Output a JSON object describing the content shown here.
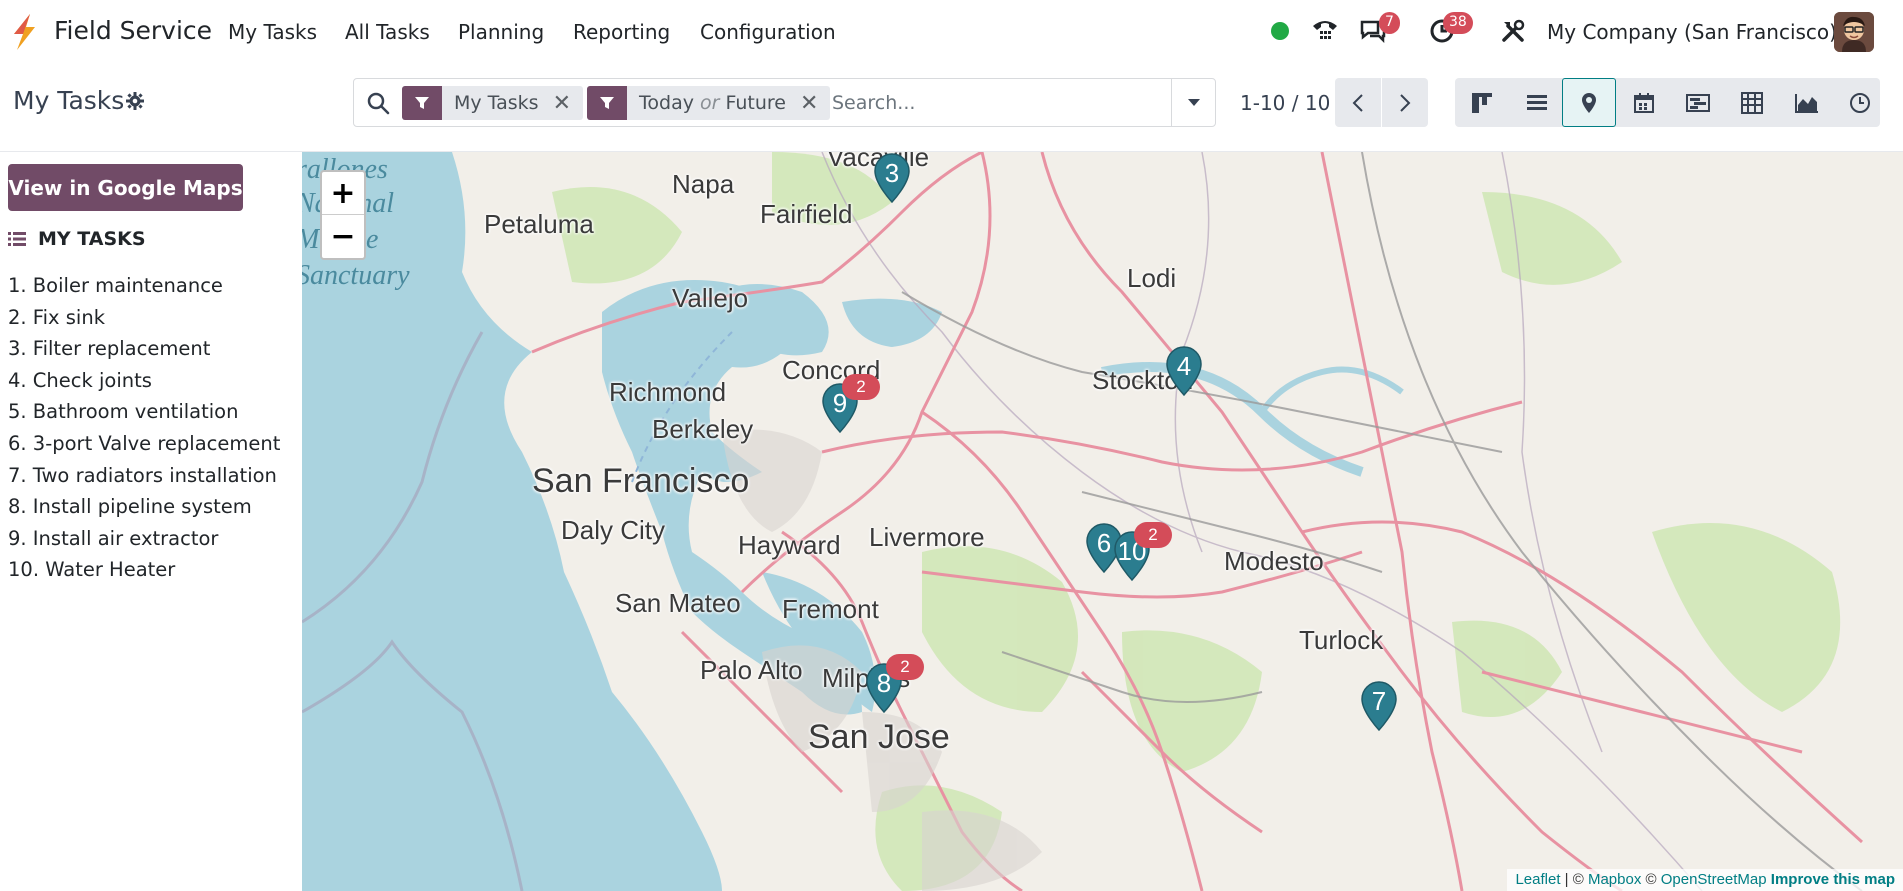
{
  "app": {
    "name": "Field Service"
  },
  "menu": [
    "My Tasks",
    "All Tasks",
    "Planning",
    "Reporting",
    "Configuration"
  ],
  "systray": {
    "status_color": "#21a945",
    "messages_count": "7",
    "activities_count": "38",
    "company": "My Company (San Francisco)"
  },
  "page": {
    "title": "My Tasks"
  },
  "search": {
    "facets": [
      {
        "label": "My Tasks"
      },
      {
        "label_a": "Today",
        "or": "or",
        "label_b": "Future"
      }
    ],
    "placeholder": "Search..."
  },
  "pager": {
    "value": "1-10 / 10"
  },
  "views": [
    "kanban",
    "list",
    "map",
    "calendar",
    "gantt",
    "pivot",
    "graph",
    "activity"
  ],
  "active_view": "map",
  "sidebar": {
    "gmaps_button": "View in Google Maps",
    "list_title": "MY TASKS",
    "tasks": [
      "1. Boiler maintenance",
      "2. Fix sink",
      "3. Filter replacement",
      "4. Check joints",
      "5. Bathroom ventilation",
      "6. 3-port Valve replacement",
      "7. Two radiators installation",
      "8. Install pipeline system",
      "9. Install air extractor",
      "10. Water Heater"
    ]
  },
  "map": {
    "places": [
      "Napa",
      "Fairfield",
      "Petaluma",
      "Vallejo",
      "Lodi",
      "Stockton",
      "Richmond",
      "Concord",
      "Berkeley",
      "San Francisco",
      "Daly City",
      "Hayward",
      "Livermore",
      "Modesto",
      "San Mateo",
      "Fremont",
      "Turlock",
      "Palo Alto",
      "Milpitas",
      "San Jose",
      "Vacaville"
    ],
    "sanctuary": [
      "rallones",
      "National",
      "Marine",
      "Sanctuary"
    ],
    "markers": [
      {
        "label": "3",
        "count": ""
      },
      {
        "label": "9",
        "count": "2"
      },
      {
        "label": "4",
        "count": ""
      },
      {
        "label": "6",
        "count": ""
      },
      {
        "label": "10",
        "count": "2"
      },
      {
        "label": "8",
        "count": "2"
      },
      {
        "label": "7",
        "count": ""
      }
    ],
    "zoom_in": "+",
    "zoom_out": "−",
    "attribution": {
      "leaflet": "Leaflet",
      "sep1": " | © ",
      "mapbox": "Mapbox",
      "sep2": " © ",
      "osm": "OpenStreetMap",
      "improve": "Improve this map"
    },
    "marker_color": "#2b7d8f",
    "badge_color": "#d44c59"
  }
}
